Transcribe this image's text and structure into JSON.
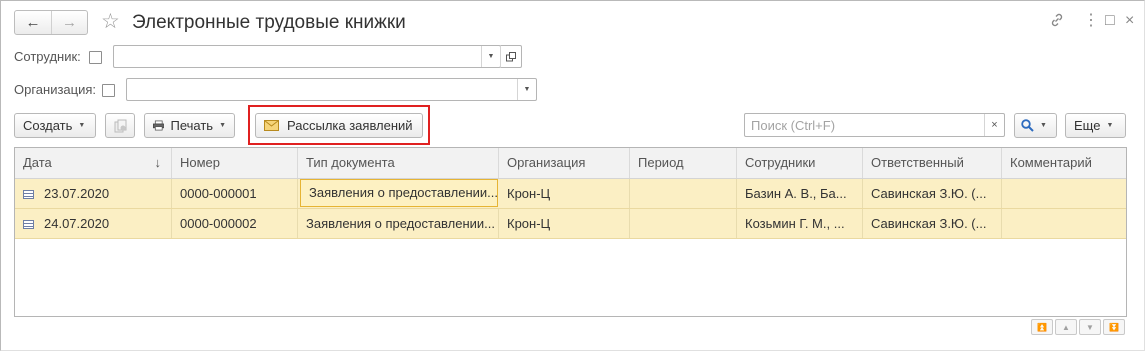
{
  "window": {
    "title": "Электронные трудовые книжки",
    "back_icon": "←",
    "forward_icon": "→",
    "star_icon": "☆",
    "link_icon": "🔗",
    "menu_icon": "⋮",
    "maximize_icon": "□",
    "close_icon": "×"
  },
  "filters": {
    "employee_label": "Сотрудник:",
    "employee_value": "",
    "organization_label": "Организация:",
    "organization_value": ""
  },
  "toolbar": {
    "create_label": "Создать",
    "print_label": "Печать",
    "mailing_label": "Рассылка заявлений",
    "search_placeholder": "Поиск (Ctrl+F)",
    "more_label": "Еще",
    "caret": "▼",
    "clear_icon": "×",
    "search_icon": "🔍",
    "highlight_color": "#e02020"
  },
  "table": {
    "columns": [
      "Дата",
      "Номер",
      "Тип документа",
      "Организация",
      "Период",
      "Сотрудники",
      "Ответственный",
      "Комментарий"
    ],
    "sort_indicator": "↓",
    "rows": [
      {
        "date": "23.07.2020",
        "number": "0000-000001",
        "doc_type": "Заявления о предоставлении...",
        "organization": "Крон-Ц",
        "period": "",
        "employees": "Базин А. В., Ба...",
        "responsible": "Савинская З.Ю. (...",
        "comment": ""
      },
      {
        "date": "24.07.2020",
        "number": "0000-000002",
        "doc_type": "Заявления о предоставлении...",
        "organization": "Крон-Ц",
        "period": "",
        "employees": "Козьмин Г. М., ...",
        "responsible": "Савинская З.Ю. (...",
        "comment": ""
      }
    ]
  },
  "scroll_buttons": [
    "⏫",
    "▲",
    "▼",
    "⏬"
  ]
}
